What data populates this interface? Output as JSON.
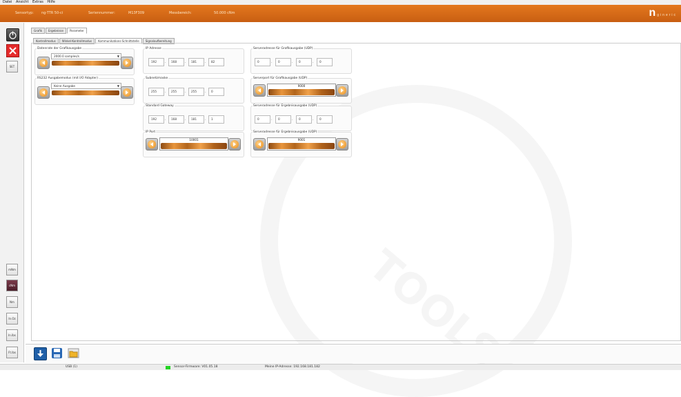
{
  "menu": [
    "Datei",
    "Ansicht",
    "Extras",
    "Hilfe"
  ],
  "info": {
    "sensortyp_label": "Sensortyp:",
    "sensortyp_value": "ng-TTR 50-ci",
    "serien_label": "Seriennummer:",
    "serien_value": "M13F309",
    "mess_label": "Messbereich:",
    "mess_value": "50.000 cNm",
    "logo_first": "n",
    "logo_rest": "gineric"
  },
  "leftbar": {
    "set": "SET",
    "units": [
      "mNm",
      "cNm",
      "Nm",
      "In.Oz",
      "In.lbs",
      "Ft.lbs"
    ]
  },
  "tabs": [
    "Grafik",
    "Ergebnisse",
    "Parameter"
  ],
  "subtabs": [
    "Kontrollmodus",
    "Winkel-Kontrollmodus",
    "Kommunikations-Schnittstelle",
    "Signalaufbereitung"
  ],
  "groups": {
    "datenrate": {
      "label": "Datenrate der Grafikausgabe",
      "value": "2000.0 samples/s"
    },
    "rs232": {
      "label": "RS232 Ausgabemodus (mit I/O Adapter)",
      "value": "Keine Ausgabe"
    },
    "ip": {
      "label": "IP Adresse",
      "octets": [
        "192",
        "168",
        "181",
        "82"
      ]
    },
    "subnet": {
      "label": "Subnetzmaske",
      "octets": [
        "255",
        "255",
        "255",
        "0"
      ]
    },
    "gateway": {
      "label": "Standard Gateway",
      "octets": [
        "192",
        "168",
        "181",
        "1"
      ]
    },
    "ipport": {
      "label": "IP Port",
      "value": "10001"
    },
    "srv_grafik": {
      "label": "Serveradresse für Grafikausgabe (UDP)",
      "octets": [
        "0",
        "0",
        "0",
        "0"
      ]
    },
    "port_grafik": {
      "label": "Serverport für Grafikausgabe (UDP)",
      "value": "9000"
    },
    "srv_ergebnis": {
      "label": "Serveradresse für Ergebnisausgabe (UDP)",
      "octets": [
        "0",
        "0",
        "0",
        "0"
      ]
    },
    "port_ergebnis": {
      "label": "Serveradresse für Ergebnisausgabe (UDP)",
      "value": "9001"
    }
  },
  "status": {
    "usb": "USB (1)",
    "firmware": "Sensor-Firmware: V01.05.18",
    "ip": "Meine IP-Adresse: 192.168.181.182"
  },
  "colors": {
    "orange": "#d86a18",
    "status_green": "#23d423",
    "close_red": "#e52b2b"
  }
}
